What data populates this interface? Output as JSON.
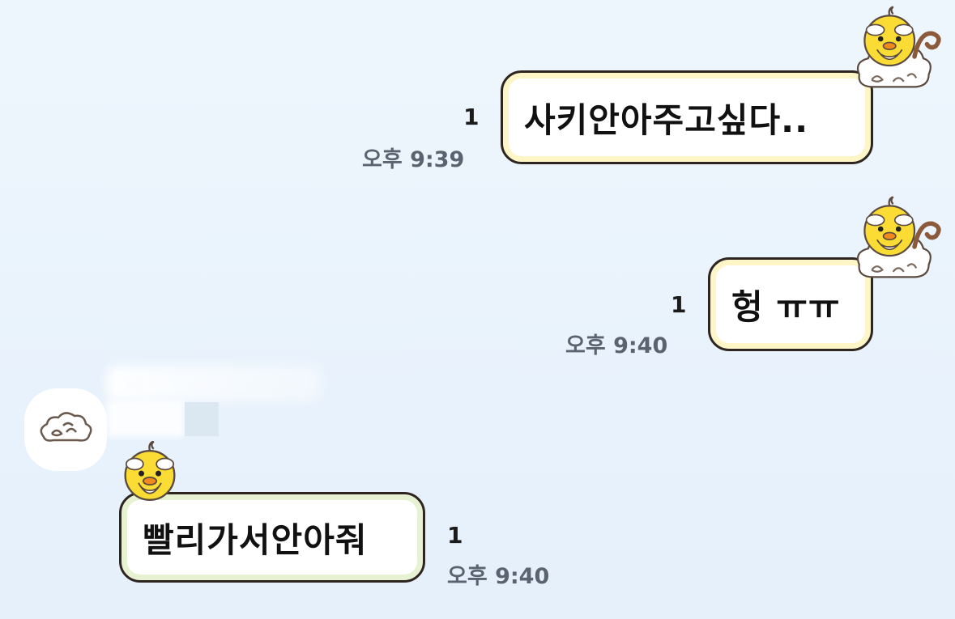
{
  "messages": [
    {
      "text": "사키안아주고싶다..",
      "unread": "1",
      "time": "오후 9:39"
    },
    {
      "text": "헝 ㅠㅠ",
      "unread": "1",
      "time": "오후 9:40"
    },
    {
      "text": "빨리가서안아줘",
      "unread": "1",
      "time": "오후 9:40"
    }
  ],
  "icons": {
    "avatar": "cloud-icon",
    "bubble_decoration": "chick-sticker-icon"
  },
  "colors": {
    "background": "#e9f3fc",
    "bubble_border": "#2e2520",
    "my_bubble_inner": "#fff6c8",
    "their_bubble_inner": "#e6f2d2",
    "time_text": "#5b6370"
  }
}
